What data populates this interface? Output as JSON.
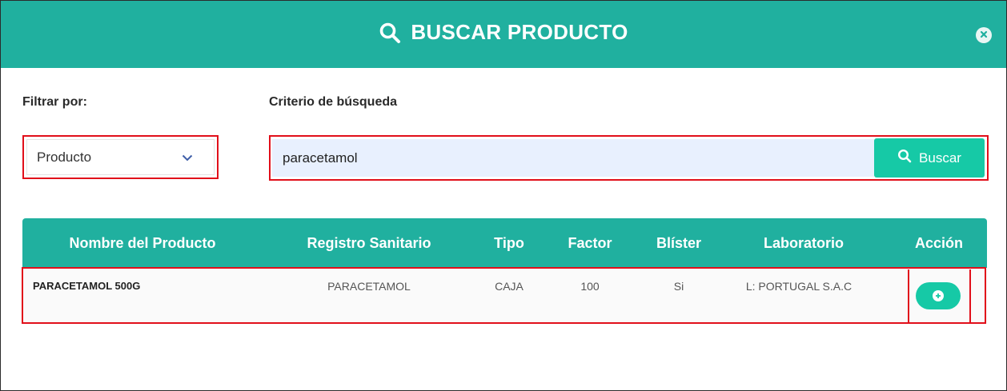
{
  "modal": {
    "title": "BUSCAR PRODUCTO",
    "header_color": "#20b09f",
    "close_icon": "close-icon"
  },
  "filter": {
    "label": "Filtrar por:",
    "selected": "Producto"
  },
  "search": {
    "label": "Criterio de búsqueda",
    "value": "paracetamol",
    "button_label": "Buscar",
    "button_color": "#16c9a6"
  },
  "table": {
    "headers": [
      "Nombre del Producto",
      "Registro Sanitario",
      "Tipo",
      "Factor",
      "Blíster",
      "Laboratorio",
      "Acción"
    ],
    "rows": [
      {
        "nombre": "PARACETAMOL 500G",
        "registro": "PARACETAMOL",
        "tipo": "CAJA",
        "factor": "100",
        "blister": "Si",
        "laboratorio": "L: PORTUGAL S.A.C",
        "accion_icon": "plus-circle-icon"
      }
    ]
  },
  "highlight_color": "#e10f1a"
}
